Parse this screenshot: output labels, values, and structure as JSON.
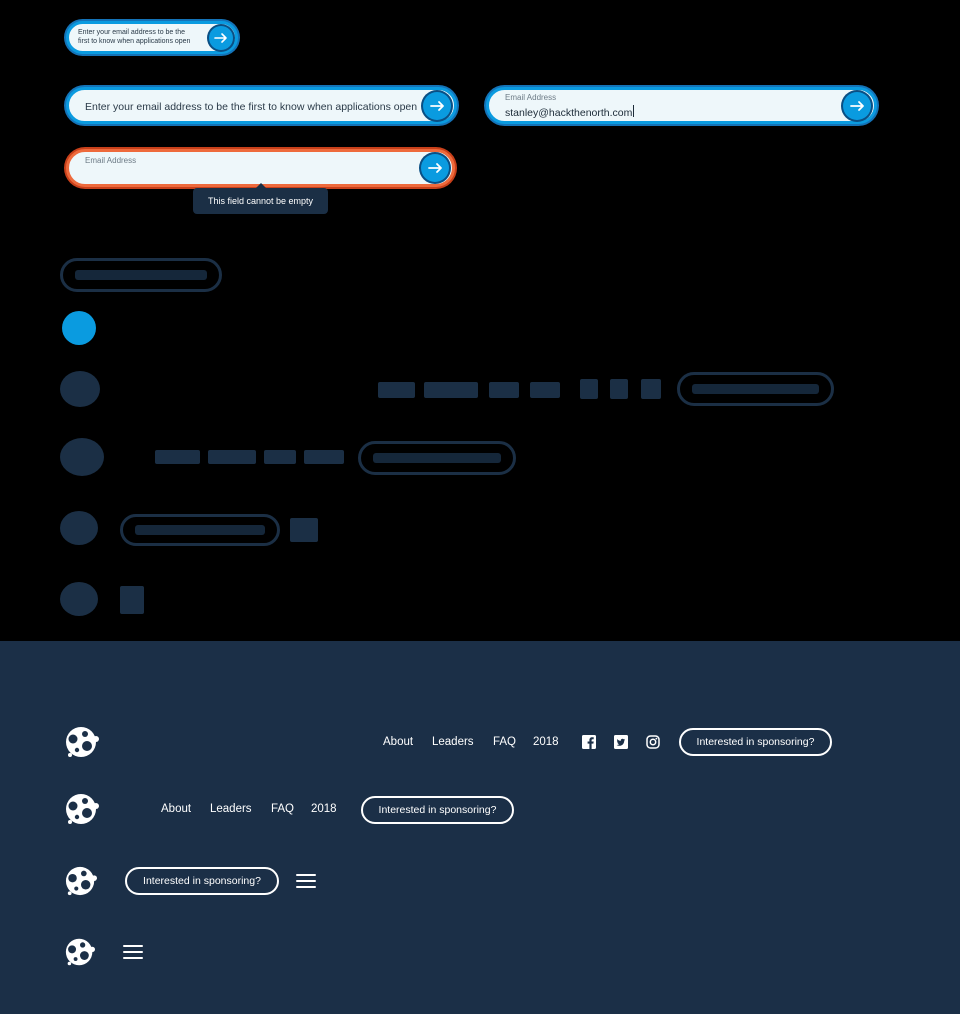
{
  "email_signup": {
    "small_placeholder_line1": "Enter your email address to be the",
    "small_placeholder_line2": "first to know when applications open",
    "large_placeholder": "Enter your email address to be the first to know when applications open",
    "field_label": "Email Address",
    "filled_value": "stanley@hackthenorth.com",
    "error_message": "This field cannot be empty",
    "submit_icon": "arrow-right-icon"
  },
  "nav": {
    "links": [
      "About",
      "Leaders",
      "FAQ",
      "2018"
    ],
    "sponsor_button": "Interested in sponsoring?",
    "social_icons": [
      "facebook-icon",
      "twitter-icon",
      "instagram-icon"
    ],
    "menu_icon": "hamburger-menu-icon",
    "logo_icon": "hack-the-north-logo-icon"
  },
  "colors": {
    "accent": "#0a9be0",
    "error": "#ee6a3c",
    "footer_bg": "#1b2f47",
    "field_bg": "#eef7fa"
  }
}
